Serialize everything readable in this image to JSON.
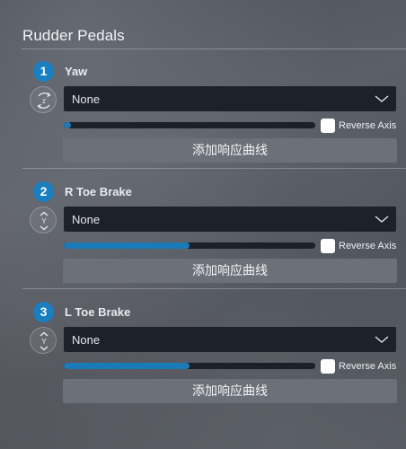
{
  "page": {
    "title": "Rudder Pedals"
  },
  "axes": [
    {
      "number": "1",
      "name": "Yaw",
      "icon": "rotate-z-icon",
      "binding": "None",
      "axis_level": 0.03,
      "reverse_label": "Reverse Axis",
      "reverse_checked": false,
      "curve_button_label": "添加响应曲线"
    },
    {
      "number": "2",
      "name": "R Toe Brake",
      "icon": "axis-y-icon",
      "binding": "None",
      "axis_level": 0.5,
      "reverse_label": "Reverse Axis",
      "reverse_checked": false,
      "curve_button_label": "添加响应曲线"
    },
    {
      "number": "3",
      "name": "L Toe Brake",
      "icon": "axis-y-icon",
      "binding": "None",
      "axis_level": 0.5,
      "reverse_label": "Reverse Axis",
      "reverse_checked": false,
      "curve_button_label": "添加响应曲线"
    }
  ],
  "colors": {
    "accent": "#1a7fc1",
    "dropdown_bg": "#1d2129",
    "button_bg": "#6c7079"
  }
}
